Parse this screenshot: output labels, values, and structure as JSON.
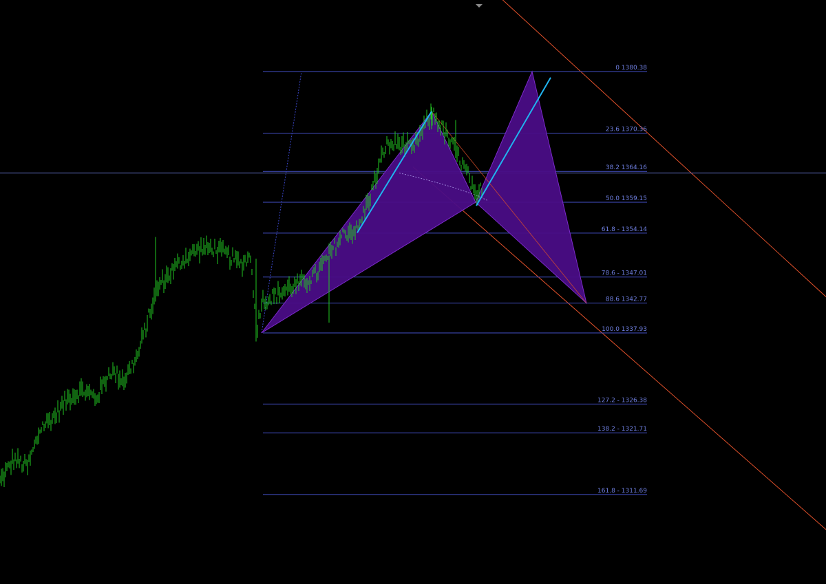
{
  "colors": {
    "background": "#000000",
    "price_series": "#22c922",
    "fib_level": "#4450c8",
    "fib_label": "#6f7fe0",
    "pattern_fill": "#4a0d86",
    "pattern_edge": "#7a2ac8",
    "trend_line": "#20b4f0",
    "channel_line": "#e0502a",
    "cursor_line": "#6b7bd8"
  },
  "chart_data": {
    "type": "line",
    "title": "",
    "xlabel": "",
    "ylabel": "",
    "grid": false,
    "legend": "none",
    "ylim": [
      1303,
      1398
    ],
    "series": [
      {
        "name": "",
        "x": [
          0,
          20,
          40,
          60,
          80,
          100,
          120,
          140,
          160,
          180,
          200,
          220,
          230,
          250,
          270,
          290,
          310,
          330,
          350,
          365,
          372,
          380,
          400,
          420,
          440,
          460,
          480,
          500,
          520,
          540,
          560,
          580,
          600,
          620,
          630,
          640,
          660,
          680,
          692,
          700
        ],
        "y": [
          1313.8,
          1317.4,
          1316.2,
          1322.7,
          1324.5,
          1327.5,
          1328.6,
          1327.4,
          1331.8,
          1330.3,
          1334.2,
          1342.1,
          1345.5,
          1348.0,
          1350.2,
          1351.6,
          1351.7,
          1350.6,
          1349.1,
          1350.5,
          1337.9,
          1343.1,
          1344.0,
          1345.3,
          1346.0,
          1347.5,
          1350.9,
          1354.2,
          1354.7,
          1361.0,
          1368.3,
          1368.7,
          1367.7,
          1372.1,
          1373.6,
          1371.5,
          1367.8,
          1363.5,
          1359.2,
          1361.8
        ]
      }
    ],
    "fib_levels": [
      {
        "label": "0 1380.38",
        "value": 1380.38
      },
      {
        "label": "23.6 1370.36",
        "value": 1370.36
      },
      {
        "label": "38.2 1364.16",
        "value": 1364.16
      },
      {
        "label": "50.0 1359.15",
        "value": 1359.15
      },
      {
        "label": "61.8 - 1354.14",
        "value": 1354.14
      },
      {
        "label": "78.6 - 1347.01",
        "value": 1347.01
      },
      {
        "label": "88.6 1342.77",
        "value": 1342.77
      },
      {
        "label": "100.0 1337.93",
        "value": 1337.93
      },
      {
        "label": "127.2 - 1326.38",
        "value": 1326.38
      },
      {
        "label": "138.2 - 1321.71",
        "value": 1321.71
      },
      {
        "label": "161.8 -  1311.69",
        "value": 1311.69
      }
    ],
    "harmonic_pattern": {
      "points": [
        {
          "x": 380,
          "y": 1337.93
        },
        {
          "x": 627,
          "y": 1373.9
        },
        {
          "x": 691,
          "y": 1359.15
        },
        {
          "x": 773,
          "y": 1380.38
        },
        {
          "x": 852,
          "y": 1342.77
        }
      ]
    },
    "trend_lines": [
      {
        "x1": 519,
        "y1": 1354.2,
        "x2": 627,
        "y2": 1373.9
      },
      {
        "x1": 692,
        "y1": 1358.6,
        "x2": 800,
        "y2": 1379.4
      }
    ],
    "channel_lines": [
      {
        "x1": 600,
        "y1": 1364.9,
        "x2": 1200,
        "y2": 1306.0
      },
      {
        "x1": 672,
        "y1": 1398.0,
        "x2": 1200,
        "y2": 1343.8
      }
    ],
    "cursor_price": 1363.9
  }
}
